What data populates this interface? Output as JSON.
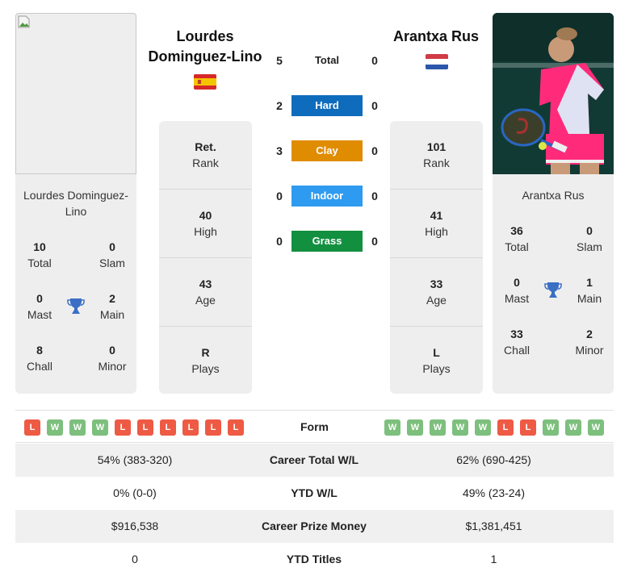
{
  "player1": {
    "name_heading": "Lourdes Dominguez-Lino",
    "card_name": "Lourdes Dominguez-Lino",
    "flag": "spain-flag",
    "titles": {
      "total": {
        "value": "10",
        "label": "Total"
      },
      "slam": {
        "value": "0",
        "label": "Slam"
      },
      "mast": {
        "value": "0",
        "label": "Mast"
      },
      "main": {
        "value": "2",
        "label": "Main"
      },
      "chall": {
        "value": "8",
        "label": "Chall"
      },
      "minor": {
        "value": "0",
        "label": "Minor"
      }
    },
    "rank": {
      "value": "Ret.",
      "label": "Rank"
    },
    "high": {
      "value": "40",
      "label": "High"
    },
    "age": {
      "value": "43",
      "label": "Age"
    },
    "plays": {
      "value": "R",
      "label": "Plays"
    },
    "form": [
      "L",
      "W",
      "W",
      "W",
      "L",
      "L",
      "L",
      "L",
      "L",
      "L"
    ]
  },
  "player2": {
    "name_heading": "Arantxa Rus",
    "card_name": "Arantxa Rus",
    "flag": "netherlands-flag",
    "titles": {
      "total": {
        "value": "36",
        "label": "Total"
      },
      "slam": {
        "value": "0",
        "label": "Slam"
      },
      "mast": {
        "value": "0",
        "label": "Mast"
      },
      "main": {
        "value": "1",
        "label": "Main"
      },
      "chall": {
        "value": "33",
        "label": "Chall"
      },
      "minor": {
        "value": "2",
        "label": "Minor"
      }
    },
    "rank": {
      "value": "101",
      "label": "Rank"
    },
    "high": {
      "value": "41",
      "label": "High"
    },
    "age": {
      "value": "33",
      "label": "Age"
    },
    "plays": {
      "value": "L",
      "label": "Plays"
    },
    "form": [
      "W",
      "W",
      "W",
      "W",
      "W",
      "L",
      "L",
      "W",
      "W",
      "W"
    ]
  },
  "h2h": [
    {
      "label": "Total",
      "p1": "5",
      "p2": "0",
      "color": null
    },
    {
      "label": "Hard",
      "p1": "2",
      "p2": "0",
      "color": "#0f6cbd"
    },
    {
      "label": "Clay",
      "p1": "3",
      "p2": "0",
      "color": "#e08c00"
    },
    {
      "label": "Indoor",
      "p1": "0",
      "p2": "0",
      "color": "#2e9bf0"
    },
    {
      "label": "Grass",
      "p1": "0",
      "p2": "0",
      "color": "#129040"
    }
  ],
  "form_label": "Form",
  "stats": [
    {
      "p1": "54% (383-320)",
      "label": "Career Total W/L",
      "p2": "62% (690-425)"
    },
    {
      "p1": "0% (0-0)",
      "label": "YTD W/L",
      "p2": "49% (23-24)"
    },
    {
      "p1": "$916,538",
      "label": "Career Prize Money",
      "p2": "$1,381,451"
    },
    {
      "p1": "0",
      "label": "YTD Titles",
      "p2": "1"
    }
  ],
  "colors": {
    "win": "#7dbf7d",
    "loss": "#ee5a44",
    "trophy": "#3a6fc4"
  }
}
